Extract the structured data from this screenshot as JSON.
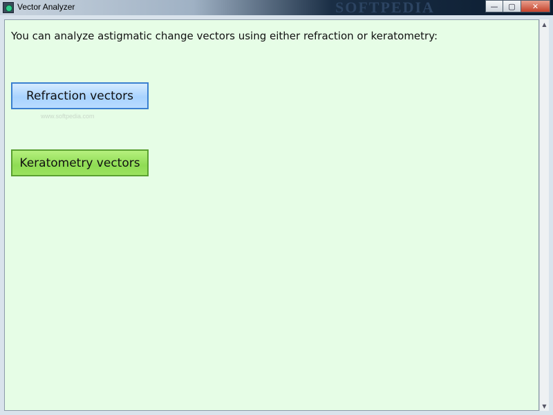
{
  "window": {
    "title": "Vector Analyzer",
    "watermark": "SOFTPEDIA",
    "controls": {
      "minimize": "—",
      "maximize": "▢",
      "close": "✕"
    }
  },
  "main": {
    "instruction": "You can analyze astigmatic change vectors using either refraction or keratometry:",
    "refraction_button": "Refraction vectors",
    "keratometry_button": "Keratometry vectors",
    "button_watermark": "www.softpedia.com"
  },
  "scrollbar": {
    "up_arrow": "▲",
    "down_arrow": "▼"
  },
  "colors": {
    "client_background": "#e6fde6",
    "refraction_button": "#a9d3ff",
    "keratometry_button": "#8fdc54"
  }
}
